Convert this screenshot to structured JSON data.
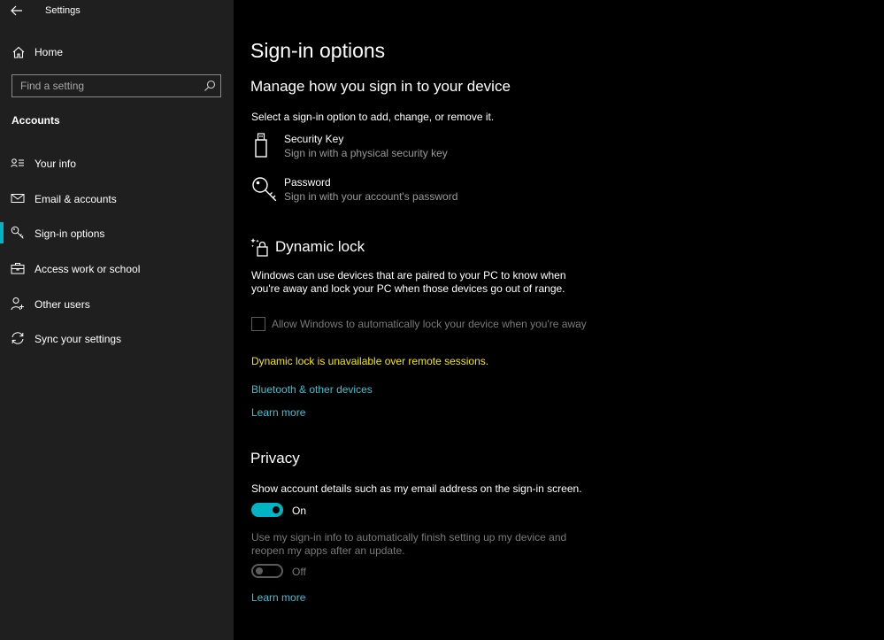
{
  "colors": {
    "accent": "#00b4c4",
    "warn": "#f3e600",
    "link": "#3fc1d2"
  },
  "window": {
    "title": "Settings"
  },
  "sidebar": {
    "home_label": "Home",
    "search_placeholder": "Find a setting",
    "section_label": "Accounts",
    "items": [
      {
        "label": "Your info",
        "icon": "person-card-icon"
      },
      {
        "label": "Email & accounts",
        "icon": "mail-icon"
      },
      {
        "label": "Sign-in options",
        "icon": "key-icon",
        "active": true
      },
      {
        "label": "Access work or school",
        "icon": "briefcase-icon"
      },
      {
        "label": "Other users",
        "icon": "person-add-icon"
      },
      {
        "label": "Sync your settings",
        "icon": "sync-icon"
      }
    ]
  },
  "main": {
    "title": "Sign-in options",
    "subtitle": "Manage how you sign in to your device",
    "instruction": "Select a sign-in option to add, change, or remove it.",
    "options": [
      {
        "title": "Security Key",
        "desc": "Sign in with a physical security key",
        "icon": "usb-key-icon"
      },
      {
        "title": "Password",
        "desc": "Sign in with your account's password",
        "icon": "password-key-icon"
      }
    ],
    "dynamic_lock": {
      "heading": "Dynamic lock",
      "desc_line1": "Windows can use devices that are paired to your PC to know when",
      "desc_line2": "you're away and lock your PC when those devices go out of range.",
      "checkbox_label": "Allow Windows to automatically lock your device when you're away",
      "checkbox_checked": false,
      "warning": "Dynamic lock is unavailable over remote sessions.",
      "bluetooth_link": "Bluetooth & other devices",
      "learn_more": "Learn more"
    },
    "privacy": {
      "heading": "Privacy",
      "show_details_text": "Show account details such as my email address on the sign-in screen.",
      "toggle1_state": "On",
      "toggle1_on": true,
      "signin_info_line1": "Use my sign-in info to automatically finish setting up my device and",
      "signin_info_line2": "reopen my apps after an update.",
      "toggle2_state": "Off",
      "toggle2_on": false,
      "learn_more": "Learn more"
    }
  }
}
